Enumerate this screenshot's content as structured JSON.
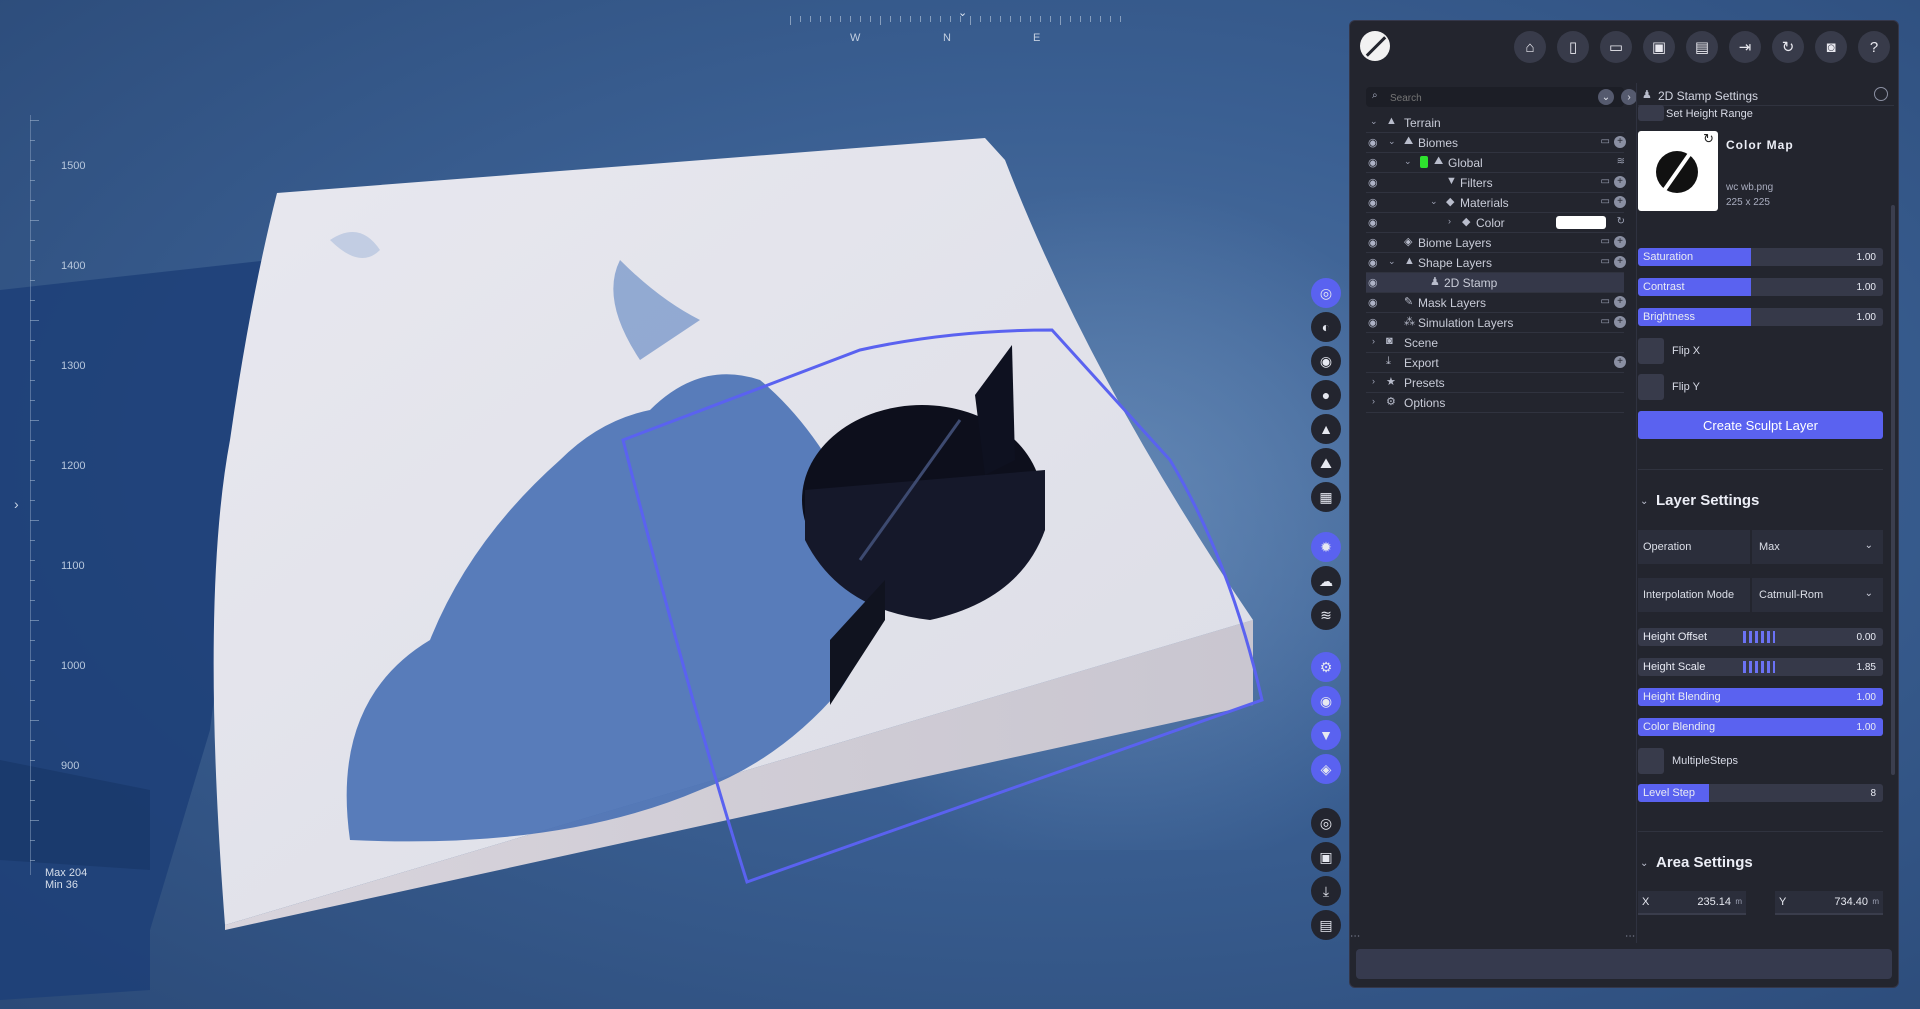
{
  "compass": {
    "directions": [
      "W",
      "N",
      "E"
    ],
    "needle": "⌄"
  },
  "ruler": {
    "labels": [
      "1500",
      "1400",
      "1300",
      "1200",
      "1100",
      "1000",
      "900"
    ],
    "max": "Max 204",
    "min": "Min 36"
  },
  "toolbar_icons": [
    "home-icon",
    "new-file-icon",
    "open-folder-icon",
    "save-icon",
    "save-as-icon",
    "export-icon",
    "refresh-icon",
    "camera-icon",
    "help-icon"
  ],
  "tree": {
    "search_placeholder": "Search",
    "items": [
      {
        "label": "Terrain"
      },
      {
        "label": "Biomes"
      },
      {
        "label": "Global"
      },
      {
        "label": "Filters"
      },
      {
        "label": "Materials"
      },
      {
        "label": "Color"
      },
      {
        "label": "Biome Layers"
      },
      {
        "label": "Shape Layers"
      },
      {
        "label": "2D Stamp"
      },
      {
        "label": "Mask Layers"
      },
      {
        "label": "Simulation Layers"
      },
      {
        "label": "Scene"
      },
      {
        "label": "Export"
      },
      {
        "label": "Presets"
      },
      {
        "label": "Options"
      }
    ]
  },
  "settings": {
    "header": "2D Stamp Settings",
    "set_height_range": "Set Height Range",
    "color_map": {
      "title": "Color Map",
      "file": "wc wb.png",
      "size": "225 x 225"
    },
    "sliders": [
      {
        "label": "Saturation",
        "value": "1.00",
        "fill": 0.46
      },
      {
        "label": "Contrast",
        "value": "1.00",
        "fill": 0.46
      },
      {
        "label": "Brightness",
        "value": "1.00",
        "fill": 0.46
      }
    ],
    "flip_x": "Flip X",
    "flip_y": "Flip Y",
    "create_button": "Create Sculpt Layer",
    "layer_settings": {
      "title": "Layer Settings",
      "operation_label": "Operation",
      "operation_value": "Max",
      "interp_label": "Interpolation Mode",
      "interp_value": "Catmull-Rom",
      "height_offset": {
        "label": "Height Offset",
        "value": "0.00"
      },
      "height_scale": {
        "label": "Height Scale",
        "value": "1.85"
      },
      "height_blending": {
        "label": "Height Blending",
        "value": "1.00",
        "fill": 1.0
      },
      "color_blending": {
        "label": "Color Blending",
        "value": "1.00",
        "fill": 1.0
      },
      "multiple_steps": "MultipleSteps",
      "level_step": {
        "label": "Level Step",
        "value": "8",
        "fill": 0.29
      }
    },
    "area_settings": {
      "title": "Area Settings",
      "x": {
        "label": "X",
        "value": "235.14",
        "unit": "m"
      },
      "y": {
        "label": "Y",
        "value": "734.40",
        "unit": "m"
      }
    }
  },
  "colors": {
    "accent": "#5a62f0",
    "panel": "#23252e",
    "green_tag": "#2ee22e"
  }
}
